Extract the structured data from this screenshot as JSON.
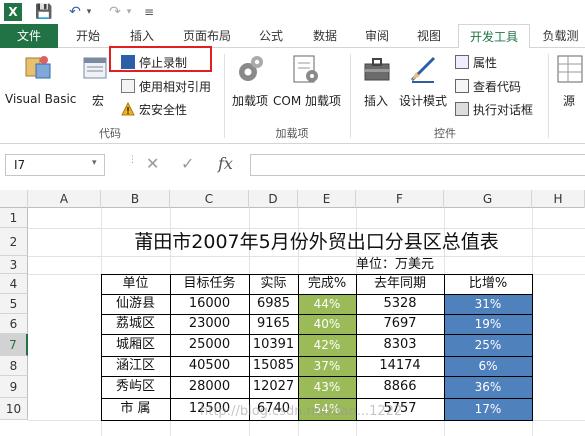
{
  "qat": {
    "excel_logo": "X",
    "save_glyph": "💾",
    "undo_glyph": "↶",
    "redo_glyph": "↷",
    "dropdown_glyph": "▾",
    "customize_glyph": "≡"
  },
  "tabs": [
    {
      "label": "文件"
    },
    {
      "label": "开始"
    },
    {
      "label": "插入"
    },
    {
      "label": "页面布局"
    },
    {
      "label": "公式"
    },
    {
      "label": "数据"
    },
    {
      "label": "审阅"
    },
    {
      "label": "视图"
    },
    {
      "label": "开发工具"
    },
    {
      "label": "负载测"
    }
  ],
  "ribbon": {
    "code": {
      "visual_basic": "Visual Basic",
      "macros": "宏",
      "stop_recording": "停止录制",
      "relative_refs": "使用相对引用",
      "macro_security": "宏安全性",
      "group_label": "代码"
    },
    "addins": {
      "addins": "加载项",
      "com_addins": "COM 加载项",
      "group_label": "加载项"
    },
    "controls": {
      "insert": "插入",
      "design_mode": "设计模式",
      "properties": "属性",
      "view_code": "查看代码",
      "run_dialog": "执行对话框",
      "group_label": "控件"
    },
    "source": {
      "label": "源"
    }
  },
  "formula_bar": {
    "name_box": "I7",
    "cancel": "✕",
    "enter": "✓",
    "fx": "fx",
    "value": ""
  },
  "columns": [
    "A",
    "B",
    "C",
    "D",
    "E",
    "F",
    "G",
    "H"
  ],
  "rows": [
    "1",
    "2",
    "3",
    "4",
    "5",
    "6",
    "7",
    "8",
    "9",
    "10"
  ],
  "sheet": {
    "title": "莆田市2007年5月份外贸出口分县区总值表",
    "unit": "单位：万美元",
    "headers": [
      "单位",
      "目标任务",
      "实际",
      "完成%",
      "去年同期",
      "比增%"
    ],
    "data": [
      [
        "仙游县",
        "16000",
        "6985",
        "44%",
        "5328",
        "31%"
      ],
      [
        "荔城区",
        "23000",
        "9165",
        "40%",
        "7697",
        "19%"
      ],
      [
        "城厢区",
        "25000",
        "10391",
        "42%",
        "8303",
        "25%"
      ],
      [
        "涵江区",
        "40500",
        "15085",
        "37%",
        "14174",
        "6%"
      ],
      [
        "秀屿区",
        "28000",
        "12027",
        "43%",
        "8866",
        "36%"
      ],
      [
        "市  属",
        "12500",
        "6740",
        "54%",
        "5757",
        "17%"
      ]
    ]
  },
  "watermark": "http://blog.csdn.net/dan...1222",
  "colors": {
    "excel_green": "#217346",
    "highlight_red": "#e02020",
    "done_fill": "#9bbb59",
    "growth_fill": "#4f81bd"
  }
}
